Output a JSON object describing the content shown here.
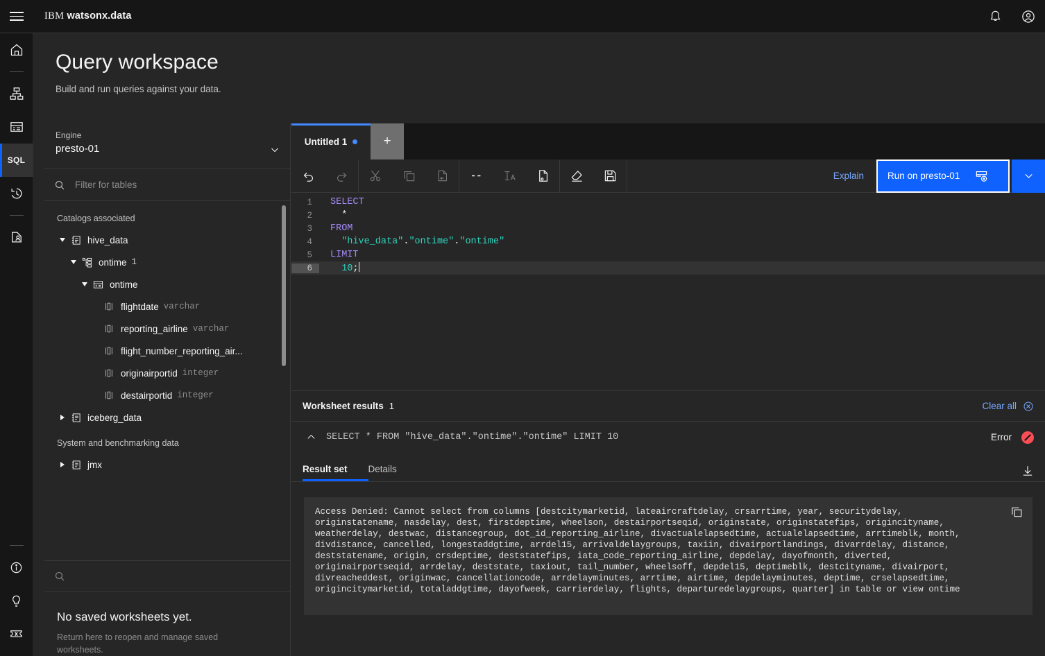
{
  "header": {
    "menu_icon": "hamburger-menu-icon",
    "brand_prefix": "IBM",
    "brand_name": "watsonx.data",
    "notifications_icon": "bell-icon",
    "account_icon": "user-avatar-icon"
  },
  "rail": {
    "items": [
      {
        "name": "home",
        "icon": "home-icon",
        "label": ""
      },
      {
        "name": "infrastructure",
        "icon": "network-icon",
        "label": ""
      },
      {
        "name": "data-manager",
        "icon": "data-table-icon",
        "label": ""
      },
      {
        "name": "query-workspace",
        "icon": "sql-text",
        "label": "SQL",
        "active": true
      },
      {
        "name": "query-history",
        "icon": "history-icon",
        "label": ""
      },
      {
        "name": "access-control",
        "icon": "shield-user-icon",
        "label": ""
      }
    ],
    "bottom_items": [
      {
        "name": "information",
        "icon": "information-icon"
      },
      {
        "name": "whats-new",
        "icon": "lightbulb-icon"
      },
      {
        "name": "tickets",
        "icon": "ticket-icon"
      }
    ]
  },
  "page": {
    "title": "Query workspace",
    "subtitle": "Build and run queries against your data."
  },
  "left_panel": {
    "engine": {
      "label": "Engine",
      "value": "presto-01",
      "caret_icon": "chevron-down-icon"
    },
    "filter": {
      "icon": "search-icon",
      "placeholder": "Filter for tables",
      "value": ""
    },
    "tree": [
      {
        "kind": "section",
        "label": "Catalogs associated"
      },
      {
        "kind": "catalog",
        "label": "hive_data",
        "icon": "catalog-icon",
        "expanded": true,
        "indent": 0
      },
      {
        "kind": "schema",
        "label": "ontime",
        "icon": "schema-icon",
        "expanded": true,
        "indent": 1,
        "count": "1"
      },
      {
        "kind": "table",
        "label": "ontime",
        "icon": "table-icon",
        "expanded": true,
        "indent": 2
      },
      {
        "kind": "column",
        "label": "flightdate",
        "icon": "column-icon",
        "type": "varchar",
        "indent": 3
      },
      {
        "kind": "column",
        "label": "reporting_airline",
        "icon": "column-icon",
        "type": "varchar",
        "indent": 3
      },
      {
        "kind": "column",
        "label": "flight_number_reporting_air...",
        "icon": "column-icon",
        "type": "",
        "indent": 3
      },
      {
        "kind": "column",
        "label": "originairportid",
        "icon": "column-icon",
        "type": "integer",
        "indent": 3
      },
      {
        "kind": "column",
        "label": "destairportid",
        "icon": "column-icon",
        "type": "integer",
        "indent": 3
      },
      {
        "kind": "catalog",
        "label": "iceberg_data",
        "icon": "catalog-icon",
        "expanded": false,
        "indent": 0
      },
      {
        "kind": "section",
        "label": "System and benchmarking data"
      },
      {
        "kind": "catalog",
        "label": "jmx",
        "icon": "catalog-icon",
        "expanded": false,
        "indent": 0
      }
    ],
    "saved": {
      "search_icon": "search-icon",
      "search_placeholder": "",
      "empty_title": "No saved worksheets yet.",
      "empty_body": "Return here to reopen and manage saved worksheets."
    }
  },
  "editor": {
    "tabs": [
      {
        "label": "Untitled 1",
        "modified": true,
        "active": true
      }
    ],
    "add_tab_label": "+",
    "toolbar": [
      {
        "name": "undo",
        "icon": "undo-icon",
        "disabled": false
      },
      {
        "name": "redo",
        "icon": "redo-icon",
        "disabled": true
      },
      {
        "name": "cut",
        "icon": "scissors-icon",
        "disabled": true
      },
      {
        "name": "copy",
        "icon": "copy-icon",
        "disabled": true
      },
      {
        "name": "paste",
        "icon": "paste-icon",
        "disabled": true
      },
      {
        "name": "comment",
        "icon": "comment-dashes-icon",
        "disabled": false
      },
      {
        "name": "format",
        "icon": "text-format-icon",
        "disabled": true
      },
      {
        "name": "sql-snippet",
        "icon": "document-code-icon",
        "disabled": false
      },
      {
        "name": "clear-editor",
        "icon": "eraser-icon",
        "disabled": false
      },
      {
        "name": "save",
        "icon": "save-disk-icon",
        "disabled": false
      }
    ],
    "explain_label": "Explain",
    "run_label": "Run on presto-01",
    "run_icon": "run-query-icon",
    "run_caret_icon": "chevron-down-icon",
    "code_lines": [
      {
        "n": "1",
        "tokens": [
          {
            "t": "kw",
            "v": "SELECT"
          }
        ],
        "current": false
      },
      {
        "n": "2",
        "tokens": [
          {
            "t": "punc",
            "v": "  *"
          }
        ],
        "current": false
      },
      {
        "n": "3",
        "tokens": [
          {
            "t": "kw",
            "v": "FROM"
          }
        ],
        "current": false
      },
      {
        "n": "4",
        "tokens": [
          {
            "t": "str",
            "v": "  \"hive_data\""
          },
          {
            "t": "punc",
            "v": "."
          },
          {
            "t": "str",
            "v": "\"ontime\""
          },
          {
            "t": "punc",
            "v": "."
          },
          {
            "t": "str",
            "v": "\"ontime\""
          }
        ],
        "current": false
      },
      {
        "n": "5",
        "tokens": [
          {
            "t": "kw",
            "v": "LIMIT"
          }
        ],
        "current": false
      },
      {
        "n": "6",
        "tokens": [
          {
            "t": "num",
            "v": "  10"
          },
          {
            "t": "punc",
            "v": ";"
          }
        ],
        "current": true
      }
    ]
  },
  "results": {
    "title": "Worksheet results",
    "count": "1",
    "clear_all_label": "Clear all",
    "clear_all_icon": "close-circle-icon",
    "query_chevron_icon": "chevron-up-icon",
    "query_text": "SELECT * FROM \"hive_data\".\"ontime\".\"ontime\" LIMIT 10",
    "status_label": "Error",
    "status_icon": "error-filled-icon",
    "tabs": [
      {
        "label": "Result set",
        "active": true
      },
      {
        "label": "Details",
        "active": false
      }
    ],
    "download_icon": "download-icon",
    "copy_icon": "copy-icon",
    "error_message": "Access Denied: Cannot select from columns [destcitymarketid, lateaircraftdelay, crsarrtime, year, securitydelay, originstatename, nasdelay, dest, firstdeptime, wheelson, destairportseqid, originstate, originstatefips, origincityname, weatherdelay, destwac, distancegroup, dot_id_reporting_airline, divactualelapsedtime, actualelapsedtime, arrtimeblk, month, divdistance, cancelled, longestaddgtime, arrdel15, arrivaldelaygroups, taxiin, divairportlandings, divarrdelay, distance, deststatename, origin, crsdeptime, deststatefips, iata_code_reporting_airline, depdelay, dayofmonth, diverted, originairportseqid, arrdelay, deststate, taxiout, tail_number, wheelsoff, depdel15, deptimeblk, destcityname, divairport, divreacheddest, originwac, cancellationcode, arrdelayminutes, arrtime, airtime, depdelayminutes, deptime, crselapsedtime, origincitymarketid, totaladdgtime, dayofweek, carrierdelay, flights, departuredelaygroups, quarter] in table or view ontime"
  },
  "colors": {
    "accent_blue": "#0f62fe",
    "link_blue": "#78a9ff",
    "error_red": "#fa4d56",
    "keyword_purple": "#a78bfa",
    "string_teal": "#2dd4bf"
  }
}
